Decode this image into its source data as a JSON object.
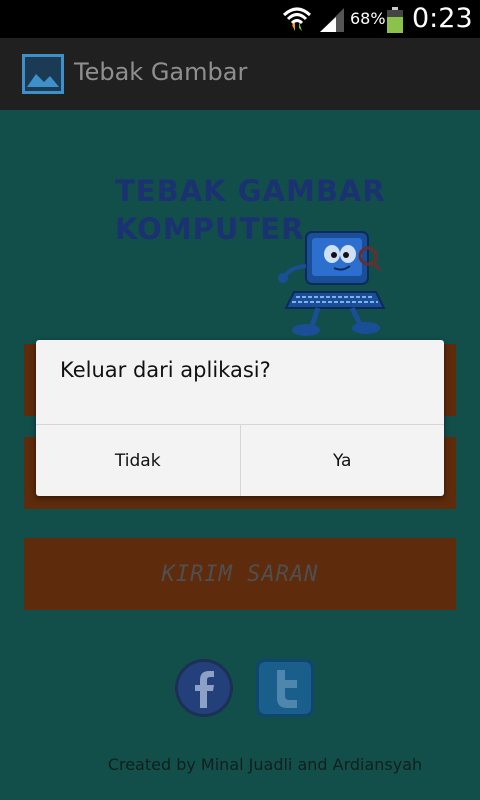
{
  "status_bar": {
    "battery_percent": "68%",
    "time": "0:23",
    "wifi_icon": "wifi-icon",
    "signal_icon": "cell-signal-icon",
    "battery_icon": "battery-icon",
    "battery_color": "#8bc34a"
  },
  "action_bar": {
    "title": "Tebak Gambar",
    "icon": "picture-icon"
  },
  "main": {
    "logo_line1": "TEBAK GAMBAR",
    "logo_line2": "KOMPUTER",
    "mascot_icon": "computer-mascot-icon",
    "buttons": [
      {
        "label": ""
      },
      {
        "label": ""
      },
      {
        "label": "KIRIM SARAN"
      }
    ],
    "social": [
      {
        "name": "facebook",
        "icon": "facebook-icon"
      },
      {
        "name": "twitter",
        "icon": "twitter-icon"
      }
    ],
    "credits": "Created by Minal Juadli and Ardiansyah"
  },
  "dialog": {
    "message": "Keluar dari aplikasi?",
    "negative_label": "Tidak",
    "positive_label": "Ya"
  },
  "colors": {
    "background": "#134f4a",
    "button": "#5e2b0c",
    "logo_text": "#1a3172",
    "dialog_bg": "#f3f3f3"
  }
}
